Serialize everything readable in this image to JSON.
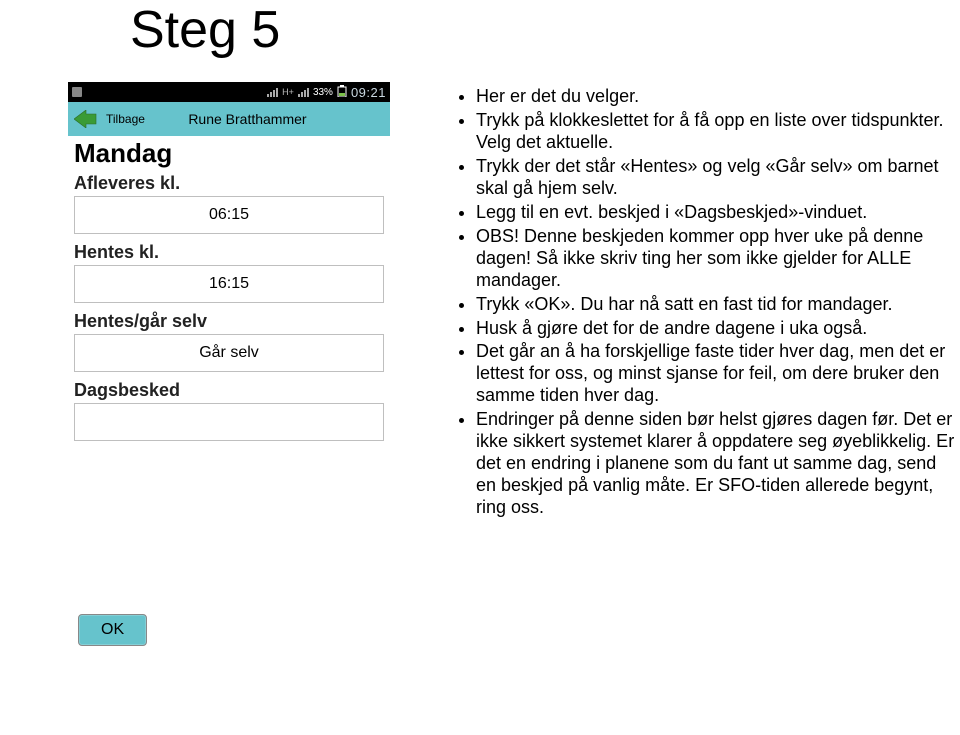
{
  "title": "Steg 5",
  "statusbar": {
    "battery": "33%",
    "time": "09:21",
    "h_label": "H+"
  },
  "topbar": {
    "back_label": "Tilbage",
    "name": "Rune Bratthammer"
  },
  "form": {
    "day_heading": "Mandag",
    "afleveres_label": "Afleveres kl.",
    "afleveres_value": "06:15",
    "hentes_label": "Hentes kl.",
    "hentes_value": "16:15",
    "hentesgaar_label": "Hentes/går selv",
    "hentesgaar_value": "Går selv",
    "dagsbesked_label": "Dagsbesked",
    "dagsbesked_value": "",
    "ok_label": "OK"
  },
  "instructions": {
    "items": [
      "Her er det du velger.",
      "Trykk på klokkeslettet for å få opp en liste over tidspunkter. Velg det aktuelle.",
      "Trykk der det står «Hentes» og velg «Går selv» om barnet skal gå hjem selv.",
      "Legg til en evt. beskjed i «Dagsbeskjed»-vinduet.",
      "OBS! Denne beskjeden kommer opp hver uke på denne dagen! Så ikke skriv ting her som ikke gjelder for ALLE mandager.",
      "Trykk «OK». Du har nå satt en fast tid for mandager.",
      "Husk å gjøre det for de andre dagene i uka også.",
      "Det går an å ha forskjellige faste tider hver dag, men det er lettest for oss, og minst sjanse for feil, om dere bruker den samme tiden hver dag.",
      "Endringer på denne siden bør helst gjøres dagen før. Det er ikke sikkert systemet klarer å oppdatere seg øyeblikkelig. Er det en endring i planene som du fant ut samme dag, send en beskjed på vanlig måte. Er SFO-tiden allerede begynt, ring oss."
    ]
  }
}
